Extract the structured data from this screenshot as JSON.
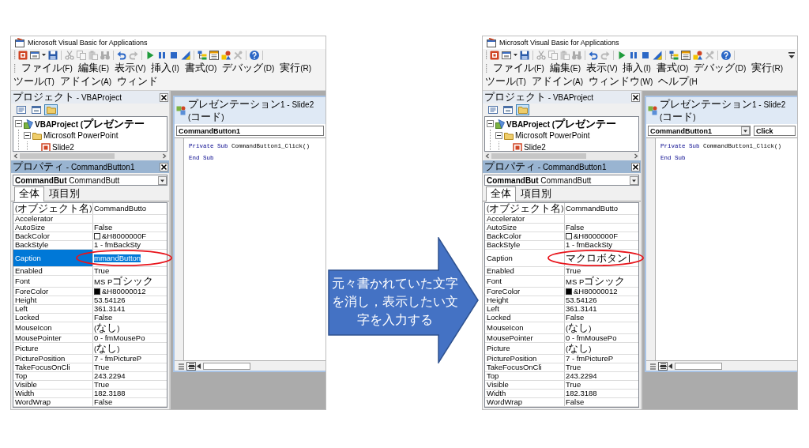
{
  "left_screenshot": {
    "window_title": "Microsoft Visual Basic for Applications",
    "toolbar": [
      {
        "buttons": [
          {
            "kind": "app",
            "disabled": false
          },
          {
            "kind": "form",
            "disabled": false
          },
          {
            "kind": "caret",
            "disabled": false
          },
          {
            "kind": "save",
            "disabled": false
          }
        ]
      },
      {
        "buttons": [
          {
            "kind": "cut",
            "disabled": true
          },
          {
            "kind": "copy",
            "disabled": true
          },
          {
            "kind": "paste",
            "disabled": true
          },
          {
            "kind": "find",
            "disabled": true
          }
        ]
      },
      {
        "buttons": [
          {
            "kind": "undo",
            "disabled": false
          },
          {
            "kind": "redo",
            "disabled": true
          }
        ]
      },
      {
        "buttons": [
          {
            "kind": "run",
            "disabled": false
          },
          {
            "kind": "pause",
            "disabled": false
          },
          {
            "kind": "stop",
            "disabled": false
          },
          {
            "kind": "design",
            "disabled": false
          }
        ]
      },
      {
        "buttons": [
          {
            "kind": "explorer",
            "disabled": false
          },
          {
            "kind": "properties",
            "disabled": false
          },
          {
            "kind": "browser",
            "disabled": false
          },
          {
            "kind": "toolbox",
            "disabled": true
          }
        ]
      },
      {
        "buttons": [
          {
            "kind": "help",
            "disabled": false
          }
        ]
      }
    ],
    "menu": [
      "ファイル(F)",
      "編集(E)",
      "表示(V)",
      "挿入(I)",
      "書式(O)",
      "デバッグ(D)",
      "実行(R)",
      "ツール(T)",
      "アドイン(A)",
      "ウィンド"
    ],
    "project_pane": {
      "title": "プロジェクト - VBAProject",
      "active": false,
      "buttons": [
        {
          "kind": "code",
          "selected": false
        },
        {
          "kind": "object",
          "selected": false
        },
        {
          "kind": "folders",
          "selected": true
        }
      ],
      "tree": [
        {
          "kind": "project",
          "label": "VBAProject (プレゼンテー",
          "expanded": true,
          "children": [
            {
              "kind": "folder",
              "label": "Microsoft PowerPoint",
              "expanded": true,
              "children": [
                {
                  "kind": "module",
                  "label": "Slide2"
                }
              ]
            }
          ]
        }
      ]
    },
    "code_window": {
      "title": "プレゼンテーション1 - Slide2 (コード)",
      "object_dropdown": "CommandButton1",
      "lines": [
        [
          {
            "kind": "keyword",
            "text": "Private Sub"
          },
          {
            "kind": "plain",
            "text": "CommandButton1_Click()"
          }
        ],
        [
          {
            "kind": "keyword",
            "text": "End Sub"
          }
        ]
      ],
      "view_buttons": [
        {
          "kind": "procedure",
          "selected": false
        },
        {
          "kind": "module",
          "selected": true
        }
      ]
    },
    "properties_pane": {
      "title": "プロパティ - CommandButton1",
      "active": true,
      "object_selector": "**CommandBut** CommandButt",
      "tabs": [
        {
          "label": "全体",
          "selected": true
        },
        {
          "label": "項目別",
          "selected": false
        }
      ],
      "rows": [
        {
          "name": "(オブジェクト名)",
          "value": "CommandButto",
          "selected": false,
          "circled": false,
          "caret": false
        },
        {
          "name": "Accelerator",
          "selected": false,
          "circled": false,
          "caret": false
        },
        {
          "name": "AutoSize",
          "value": "False",
          "selected": false,
          "circled": false,
          "caret": false
        },
        {
          "name": "BackColor",
          "value": "&H8000000F",
          "color": "#ffffff",
          "selected": false,
          "circled": false,
          "caret": false
        },
        {
          "name": "BackStyle",
          "value": "1 - fmBackSty",
          "selected": false,
          "circled": false,
          "caret": false
        },
        {
          "name": "Caption",
          "value": "mmandButton",
          "selected": true,
          "circled": true,
          "caret": false
        },
        {
          "name": "Enabled",
          "value": "True",
          "selected": false,
          "circled": false,
          "caret": false
        },
        {
          "name": "Font",
          "value": "MS Pゴシック",
          "selected": false,
          "circled": false,
          "caret": false
        },
        {
          "name": "ForeColor",
          "value": "&H80000012",
          "color": "#000000",
          "selected": false,
          "circled": false,
          "caret": false
        },
        {
          "name": "Height",
          "value": "53.54126",
          "selected": false,
          "circled": false,
          "caret": false
        },
        {
          "name": "Left",
          "value": "361.3141",
          "selected": false,
          "circled": false,
          "caret": false
        },
        {
          "name": "Locked",
          "value": "False",
          "selected": false,
          "circled": false,
          "caret": false
        },
        {
          "name": "MouseIcon",
          "value": "(なし)",
          "selected": false,
          "circled": false,
          "caret": false
        },
        {
          "name": "MousePointer",
          "value": "0 - fmMousePo",
          "selected": false,
          "circled": false,
          "caret": false
        },
        {
          "name": "Picture",
          "value": "(なし)",
          "selected": false,
          "circled": false,
          "caret": false
        },
        {
          "name": "PicturePosition",
          "value": "7 - fmPictureP",
          "selected": false,
          "circled": false,
          "caret": false
        },
        {
          "name": "TakeFocusOnCli",
          "value": "True",
          "selected": false,
          "circled": false,
          "caret": false
        },
        {
          "name": "Top",
          "value": "243.2294",
          "selected": false,
          "circled": false,
          "caret": false
        },
        {
          "name": "Visible",
          "value": "True",
          "selected": false,
          "circled": false,
          "caret": false
        },
        {
          "name": "Width",
          "value": "182.3188",
          "selected": false,
          "circled": false,
          "caret": false
        },
        {
          "name": "WordWrap",
          "value": "False",
          "selected": false,
          "circled": false,
          "caret": false
        }
      ]
    }
  },
  "callout": {
    "text": "元々書かれていた文字を消し，表示したい文字を入力する"
  },
  "right_screenshot": {
    "window_title": "Microsoft Visual Basic for Applications",
    "toolbar": [
      {
        "buttons": [
          {
            "kind": "app",
            "disabled": false
          },
          {
            "kind": "form",
            "disabled": false
          },
          {
            "kind": "caret",
            "disabled": false
          },
          {
            "kind": "save",
            "disabled": false
          }
        ]
      },
      {
        "buttons": [
          {
            "kind": "cut",
            "disabled": true
          },
          {
            "kind": "copy",
            "disabled": true
          },
          {
            "kind": "paste",
            "disabled": true
          },
          {
            "kind": "find",
            "disabled": true
          }
        ]
      },
      {
        "buttons": [
          {
            "kind": "undo",
            "disabled": false
          },
          {
            "kind": "redo",
            "disabled": true
          }
        ]
      },
      {
        "buttons": [
          {
            "kind": "run",
            "disabled": false
          },
          {
            "kind": "pause",
            "disabled": false
          },
          {
            "kind": "stop",
            "disabled": false
          },
          {
            "kind": "design",
            "disabled": false
          }
        ]
      },
      {
        "buttons": [
          {
            "kind": "explorer",
            "disabled": false
          },
          {
            "kind": "properties",
            "disabled": false
          },
          {
            "kind": "browser",
            "disabled": false
          },
          {
            "kind": "toolbox",
            "disabled": true
          }
        ]
      },
      {
        "buttons": [
          {
            "kind": "help",
            "disabled": false
          }
        ]
      }
    ],
    "toolbar_options": true,
    "menu": [
      "ファイル(F)",
      "編集(E)",
      "表示(V)",
      "挿入(I)",
      "書式(O)",
      "デバッグ(D)",
      "実行(R)",
      "ツール(T)",
      "アドイン(A)",
      "ウィンドウ(W)",
      "ヘルプ(H"
    ],
    "project_pane": {
      "title": "プロジェクト - VBAProject",
      "active": false,
      "buttons": [
        {
          "kind": "code",
          "selected": false
        },
        {
          "kind": "object",
          "selected": false
        },
        {
          "kind": "folders",
          "selected": true
        }
      ],
      "tree": [
        {
          "kind": "project",
          "label": "VBAProject (プレゼンテー",
          "expanded": true,
          "children": [
            {
              "kind": "folder",
              "label": "Microsoft PowerPoint",
              "expanded": true,
              "children": [
                {
                  "kind": "module",
                  "label": "Slide2"
                }
              ]
            }
          ]
        }
      ]
    },
    "code_window": {
      "title": "プレゼンテーション1 - Slide2 (コード)",
      "object_dropdown": "CommandButton1",
      "procedure_dropdown": "Click",
      "lines": [
        [
          {
            "kind": "keyword",
            "text": "Private Sub"
          },
          {
            "kind": "plain",
            "text": "CommandButton1_Click()"
          }
        ],
        [
          {
            "kind": "keyword",
            "text": "End Sub"
          }
        ]
      ],
      "view_buttons": [
        {
          "kind": "procedure",
          "selected": false
        },
        {
          "kind": "module",
          "selected": true
        }
      ]
    },
    "properties_pane": {
      "title": "プロパティ - CommandButton1",
      "active": true,
      "object_selector": "**CommandBut** CommandButt",
      "tabs": [
        {
          "label": "全体",
          "selected": true
        },
        {
          "label": "項目別",
          "selected": false
        }
      ],
      "rows": [
        {
          "name": "(オブジェクト名)",
          "value": "CommandButto",
          "selected": false,
          "circled": false,
          "caret": false
        },
        {
          "name": "Accelerator",
          "selected": false,
          "circled": false,
          "caret": false
        },
        {
          "name": "AutoSize",
          "value": "False",
          "selected": false,
          "circled": false,
          "caret": false
        },
        {
          "name": "BackColor",
          "value": "&H8000000F",
          "color": "#ffffff",
          "selected": false,
          "circled": false,
          "caret": false
        },
        {
          "name": "BackStyle",
          "value": "1 - fmBackSty",
          "selected": false,
          "circled": false,
          "caret": false
        },
        {
          "name": "Caption",
          "value": "マクロボタン",
          "selected": false,
          "circled": true,
          "caret": true
        },
        {
          "name": "Enabled",
          "value": "True",
          "selected": false,
          "circled": false,
          "caret": false
        },
        {
          "name": "Font",
          "value": "MS Pゴシック",
          "selected": false,
          "circled": false,
          "caret": false
        },
        {
          "name": "ForeColor",
          "value": "&H80000012",
          "color": "#000000",
          "selected": false,
          "circled": false,
          "caret": false
        },
        {
          "name": "Height",
          "value": "53.54126",
          "selected": false,
          "circled": false,
          "caret": false
        },
        {
          "name": "Left",
          "value": "361.3141",
          "selected": false,
          "circled": false,
          "caret": false
        },
        {
          "name": "Locked",
          "value": "False",
          "selected": false,
          "circled": false,
          "caret": false
        },
        {
          "name": "MouseIcon",
          "value": "(なし)",
          "selected": false,
          "circled": false,
          "caret": false
        },
        {
          "name": "MousePointer",
          "value": "0 - fmMousePo",
          "selected": false,
          "circled": false,
          "caret": false
        },
        {
          "name": "Picture",
          "value": "(なし)",
          "selected": false,
          "circled": false,
          "caret": false
        },
        {
          "name": "PicturePosition",
          "value": "7 - fmPictureP",
          "selected": false,
          "circled": false,
          "caret": false
        },
        {
          "name": "TakeFocusOnCli",
          "value": "True",
          "selected": false,
          "circled": false,
          "caret": false
        },
        {
          "name": "Top",
          "value": "243.2294",
          "selected": false,
          "circled": false,
          "caret": false
        },
        {
          "name": "Visible",
          "value": "True",
          "selected": false,
          "circled": false,
          "caret": false
        },
        {
          "name": "Width",
          "value": "182.3188",
          "selected": false,
          "circled": false,
          "caret": false
        },
        {
          "name": "WordWrap",
          "value": "False",
          "selected": false,
          "circled": false,
          "caret": false
        }
      ]
    }
  }
}
